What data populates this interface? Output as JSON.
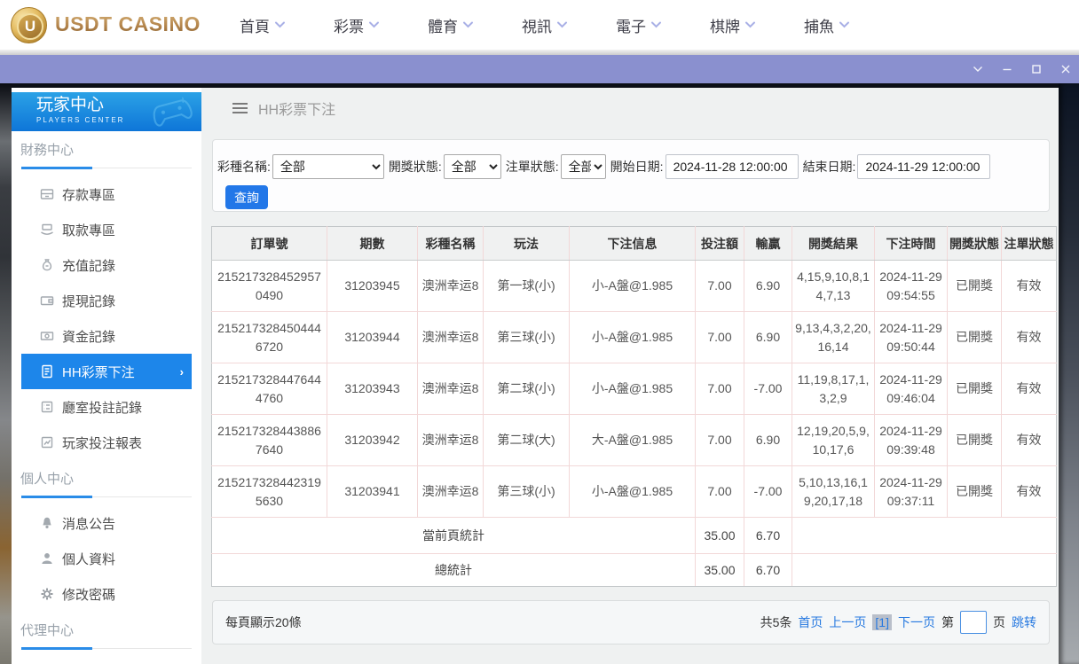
{
  "brand": {
    "name": "USDT CASINO",
    "coin_letter": "U"
  },
  "top_nav": [
    "首頁",
    "彩票",
    "體育",
    "視訊",
    "電子",
    "棋牌",
    "捕魚"
  ],
  "titlebar": {
    "controls": [
      "collapse",
      "minimize",
      "maximize",
      "close"
    ]
  },
  "sidebar": {
    "title": "玩家中心",
    "subtitle": "PLAYERS CENTER",
    "sections": [
      {
        "title": "財務中心",
        "items": [
          {
            "label": "存款專區",
            "icon": "deposit-icon"
          },
          {
            "label": "取款專區",
            "icon": "withdraw-icon"
          },
          {
            "label": "充值記錄",
            "icon": "recharge-record-icon"
          },
          {
            "label": "提現記錄",
            "icon": "withdraw-record-icon"
          },
          {
            "label": "資金記錄",
            "icon": "funds-record-icon"
          },
          {
            "label": "HH彩票下注",
            "icon": "lottery-bet-icon",
            "active": true
          },
          {
            "label": "廳室投註記錄",
            "icon": "hall-record-icon"
          },
          {
            "label": "玩家投注報表",
            "icon": "report-icon"
          }
        ]
      },
      {
        "title": "個人中心",
        "items": [
          {
            "label": "消息公告",
            "icon": "announcement-icon"
          },
          {
            "label": "個人資料",
            "icon": "profile-icon"
          },
          {
            "label": "修改密碼",
            "icon": "password-icon"
          }
        ]
      },
      {
        "title": "代理中心",
        "items": []
      }
    ]
  },
  "breadcrumb": "HH彩票下注",
  "filters": {
    "lottery_label": "彩種名稱:",
    "lottery_value": "全部",
    "draw_status_label": "開獎狀態:",
    "draw_status_value": "全部",
    "order_status_label": "注單狀態:",
    "order_status_value": "全部",
    "start_label": "開始日期:",
    "start_value": "2024-11-28 12:00:00",
    "end_label": "結束日期:",
    "end_value": "2024-11-29 12:00:00",
    "search_label": "查詢"
  },
  "table": {
    "headers": [
      "訂單號",
      "期數",
      "彩種名稱",
      "玩法",
      "下注信息",
      "投注額",
      "輸贏",
      "開獎結果",
      "下注時間",
      "開獎狀態",
      "注單狀態"
    ],
    "rows": [
      [
        "2152173284529570490",
        "31203945",
        "澳洲幸运8",
        "第一球(小)",
        "小-A盤@1.985",
        "7.00",
        "6.90",
        "4,15,9,10,8,14,7,13",
        "2024-11-29 09:54:55",
        "已開獎",
        "有效"
      ],
      [
        "2152173284504446720",
        "31203944",
        "澳洲幸运8",
        "第三球(小)",
        "小-A盤@1.985",
        "7.00",
        "6.90",
        "9,13,4,3,2,20,16,14",
        "2024-11-29 09:50:44",
        "已開獎",
        "有效"
      ],
      [
        "2152173284476444760",
        "31203943",
        "澳洲幸运8",
        "第二球(小)",
        "小-A盤@1.985",
        "7.00",
        "-7.00",
        "11,19,8,17,1,3,2,9",
        "2024-11-29 09:46:04",
        "已開獎",
        "有效"
      ],
      [
        "2152173284438867640",
        "31203942",
        "澳洲幸运8",
        "第二球(大)",
        "大-A盤@1.985",
        "7.00",
        "6.90",
        "12,19,20,5,9,10,17,6",
        "2024-11-29 09:39:48",
        "已開獎",
        "有效"
      ],
      [
        "2152173284423195630",
        "31203941",
        "澳洲幸运8",
        "第三球(小)",
        "小-A盤@1.985",
        "7.00",
        "-7.00",
        "5,10,13,16,19,20,17,18",
        "2024-11-29 09:37:11",
        "已開獎",
        "有效"
      ]
    ],
    "page_summary": {
      "label": "當前頁統計",
      "bet": "35.00",
      "win": "6.70"
    },
    "total_summary": {
      "label": "總統計",
      "bet": "35.00",
      "win": "6.70"
    }
  },
  "pagination": {
    "page_size_text": "每頁顯示20條",
    "total_text": "共5条",
    "first": "首页",
    "prev": "上一页",
    "current": "[1]",
    "next": "下一页",
    "jump_prefix": "第",
    "jump_suffix": "页",
    "jump_action": "跳转",
    "jump_value": ""
  }
}
